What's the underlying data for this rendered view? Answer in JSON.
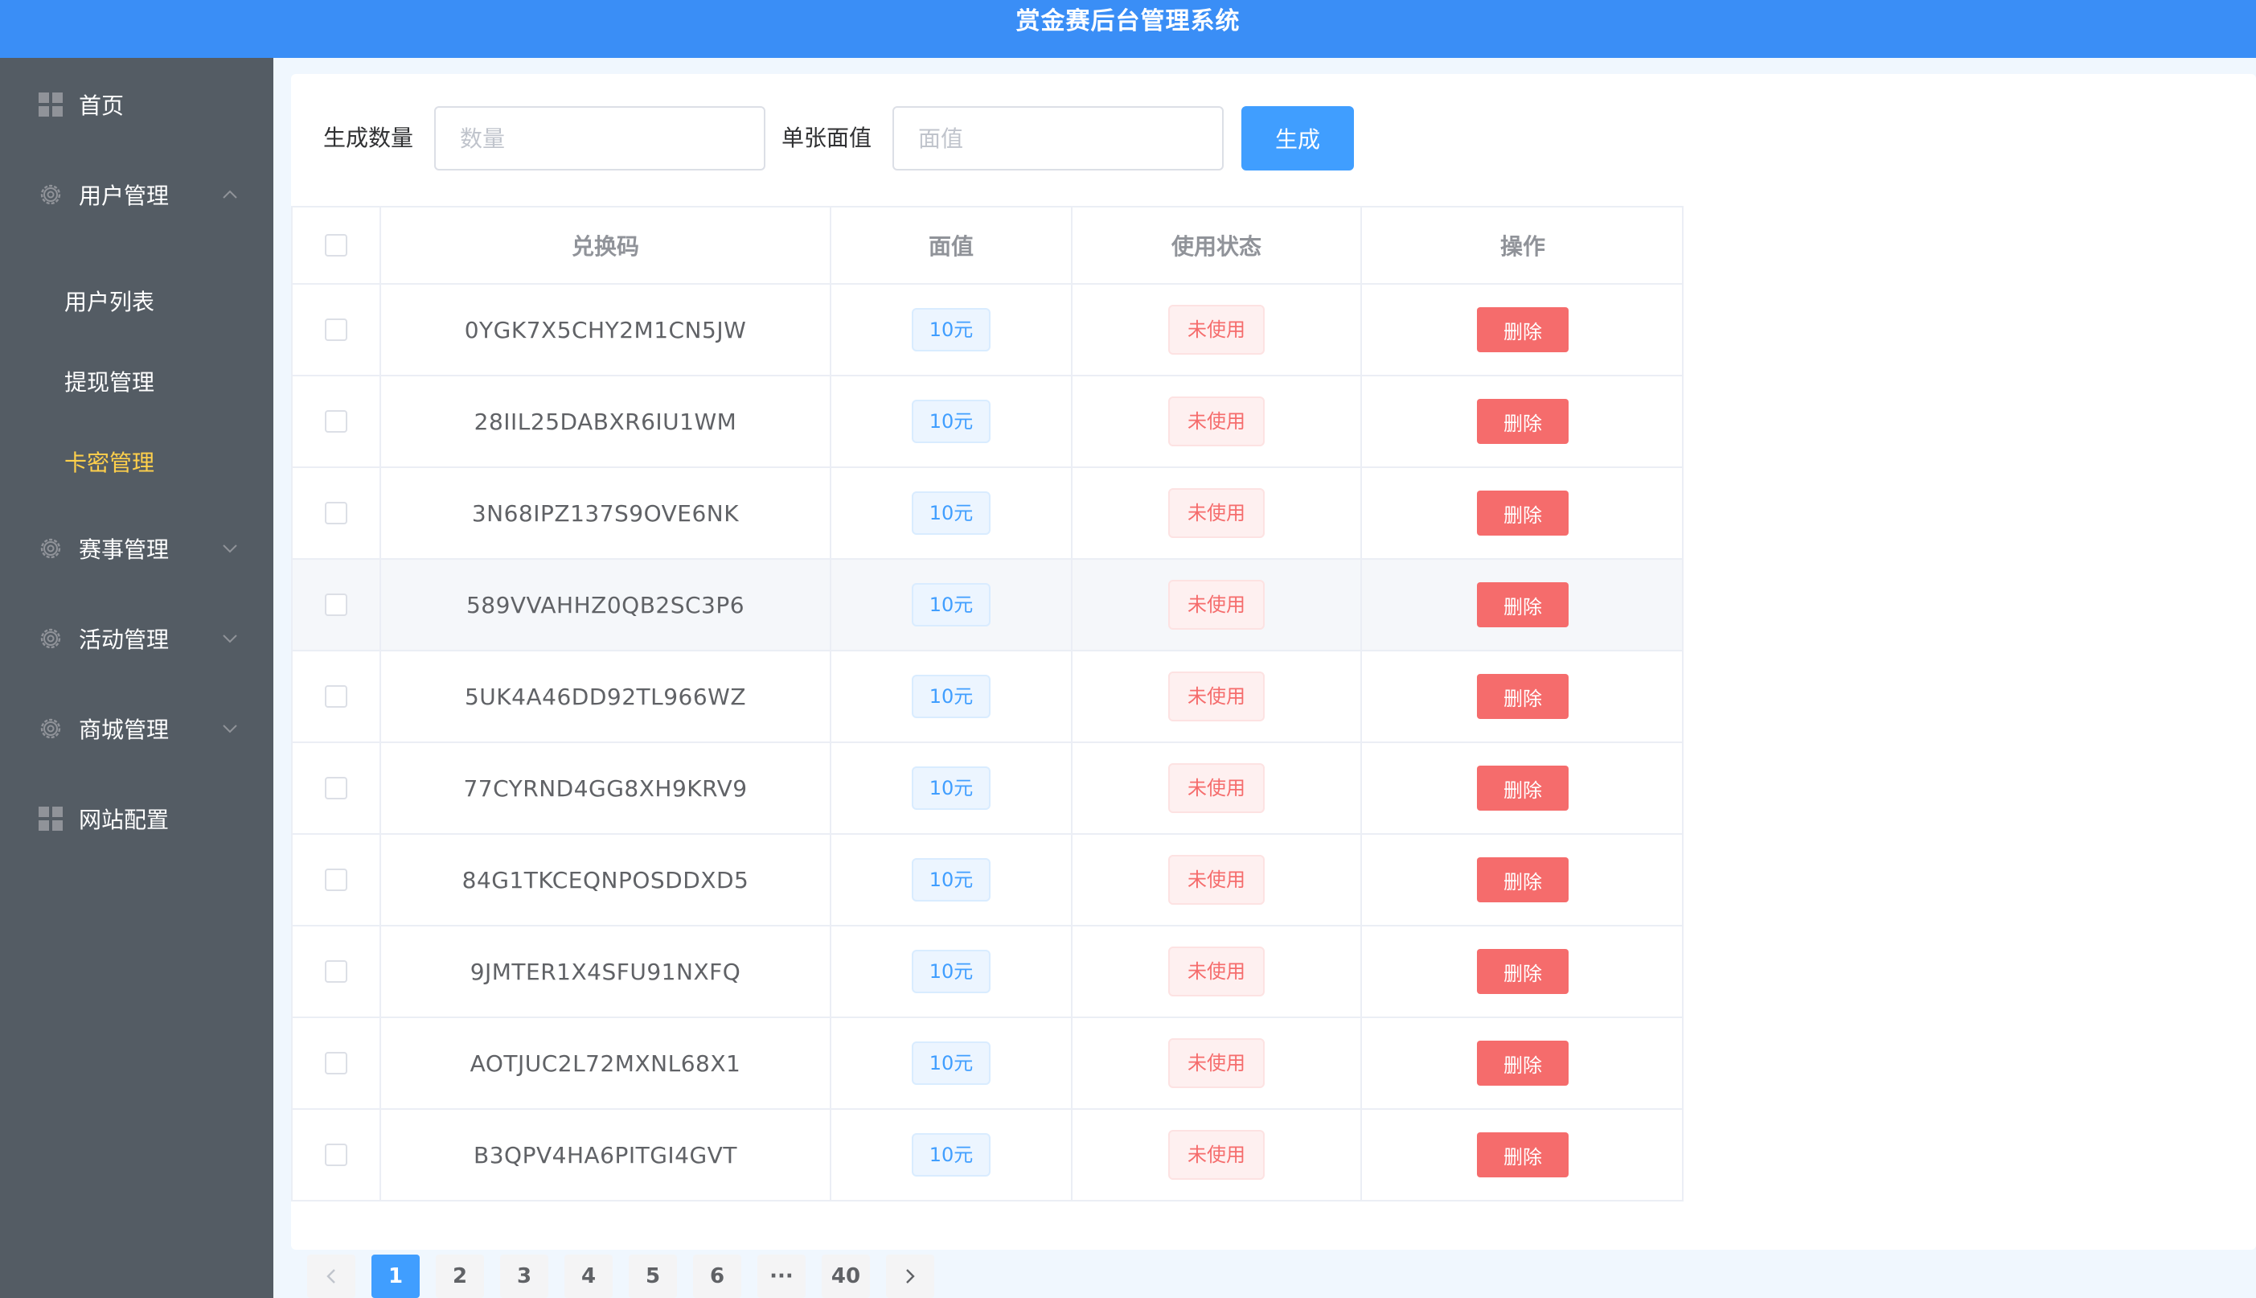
{
  "header": {
    "title": "赏金赛后台管理系统"
  },
  "sidebar": {
    "items": [
      {
        "label": "首页",
        "icon": "grid-icon"
      },
      {
        "label": "用户管理",
        "icon": "gear-icon",
        "expanded": true
      },
      {
        "label": "赛事管理",
        "icon": "gear-icon"
      },
      {
        "label": "活动管理",
        "icon": "gear-icon"
      },
      {
        "label": "商城管理",
        "icon": "gear-icon"
      },
      {
        "label": "网站配置",
        "icon": "grid-icon"
      }
    ],
    "submenu": [
      {
        "label": "用户列表"
      },
      {
        "label": "提现管理"
      },
      {
        "label": "卡密管理",
        "active": true
      }
    ],
    "active_color": "#ffd04b"
  },
  "filter": {
    "quantity_label": "生成数量",
    "quantity_placeholder": "数量",
    "value_label": "单张面值",
    "value_placeholder": "面值",
    "generate_button": "生成"
  },
  "table": {
    "columns": [
      "兑换码",
      "面值",
      "使用状态",
      "操作"
    ],
    "rows": [
      {
        "code": "0YGK7X5CHY2M1CN5JW",
        "value": "10元",
        "status": "未使用",
        "action": "删除"
      },
      {
        "code": "28IIL25DABXR6IU1WM",
        "value": "10元",
        "status": "未使用",
        "action": "删除"
      },
      {
        "code": "3N68IPZ137S9OVE6NK",
        "value": "10元",
        "status": "未使用",
        "action": "删除"
      },
      {
        "code": "589VVAHHZ0QB2SC3P6",
        "value": "10元",
        "status": "未使用",
        "action": "删除"
      },
      {
        "code": "5UK4A46DD92TL966WZ",
        "value": "10元",
        "status": "未使用",
        "action": "删除"
      },
      {
        "code": "77CYRND4GG8XH9KRV9",
        "value": "10元",
        "status": "未使用",
        "action": "删除"
      },
      {
        "code": "84G1TKCEQNPOSDDXD5",
        "value": "10元",
        "status": "未使用",
        "action": "删除"
      },
      {
        "code": "9JMTER1X4SFU91NXFQ",
        "value": "10元",
        "status": "未使用",
        "action": "删除"
      },
      {
        "code": "AOTJUC2L72MXNL68X1",
        "value": "10元",
        "status": "未使用",
        "action": "删除"
      },
      {
        "code": "B3QPV4HA6PITGI4GVT",
        "value": "10元",
        "status": "未使用",
        "action": "删除"
      }
    ]
  },
  "pagination": {
    "pages": [
      "1",
      "2",
      "3",
      "4",
      "5",
      "6",
      "···",
      "40"
    ],
    "current": "1"
  },
  "colors": {
    "header_bg": "#3a8ef6",
    "sidebar_bg": "#545c64",
    "primary": "#409eff",
    "danger": "#f56c6c"
  }
}
